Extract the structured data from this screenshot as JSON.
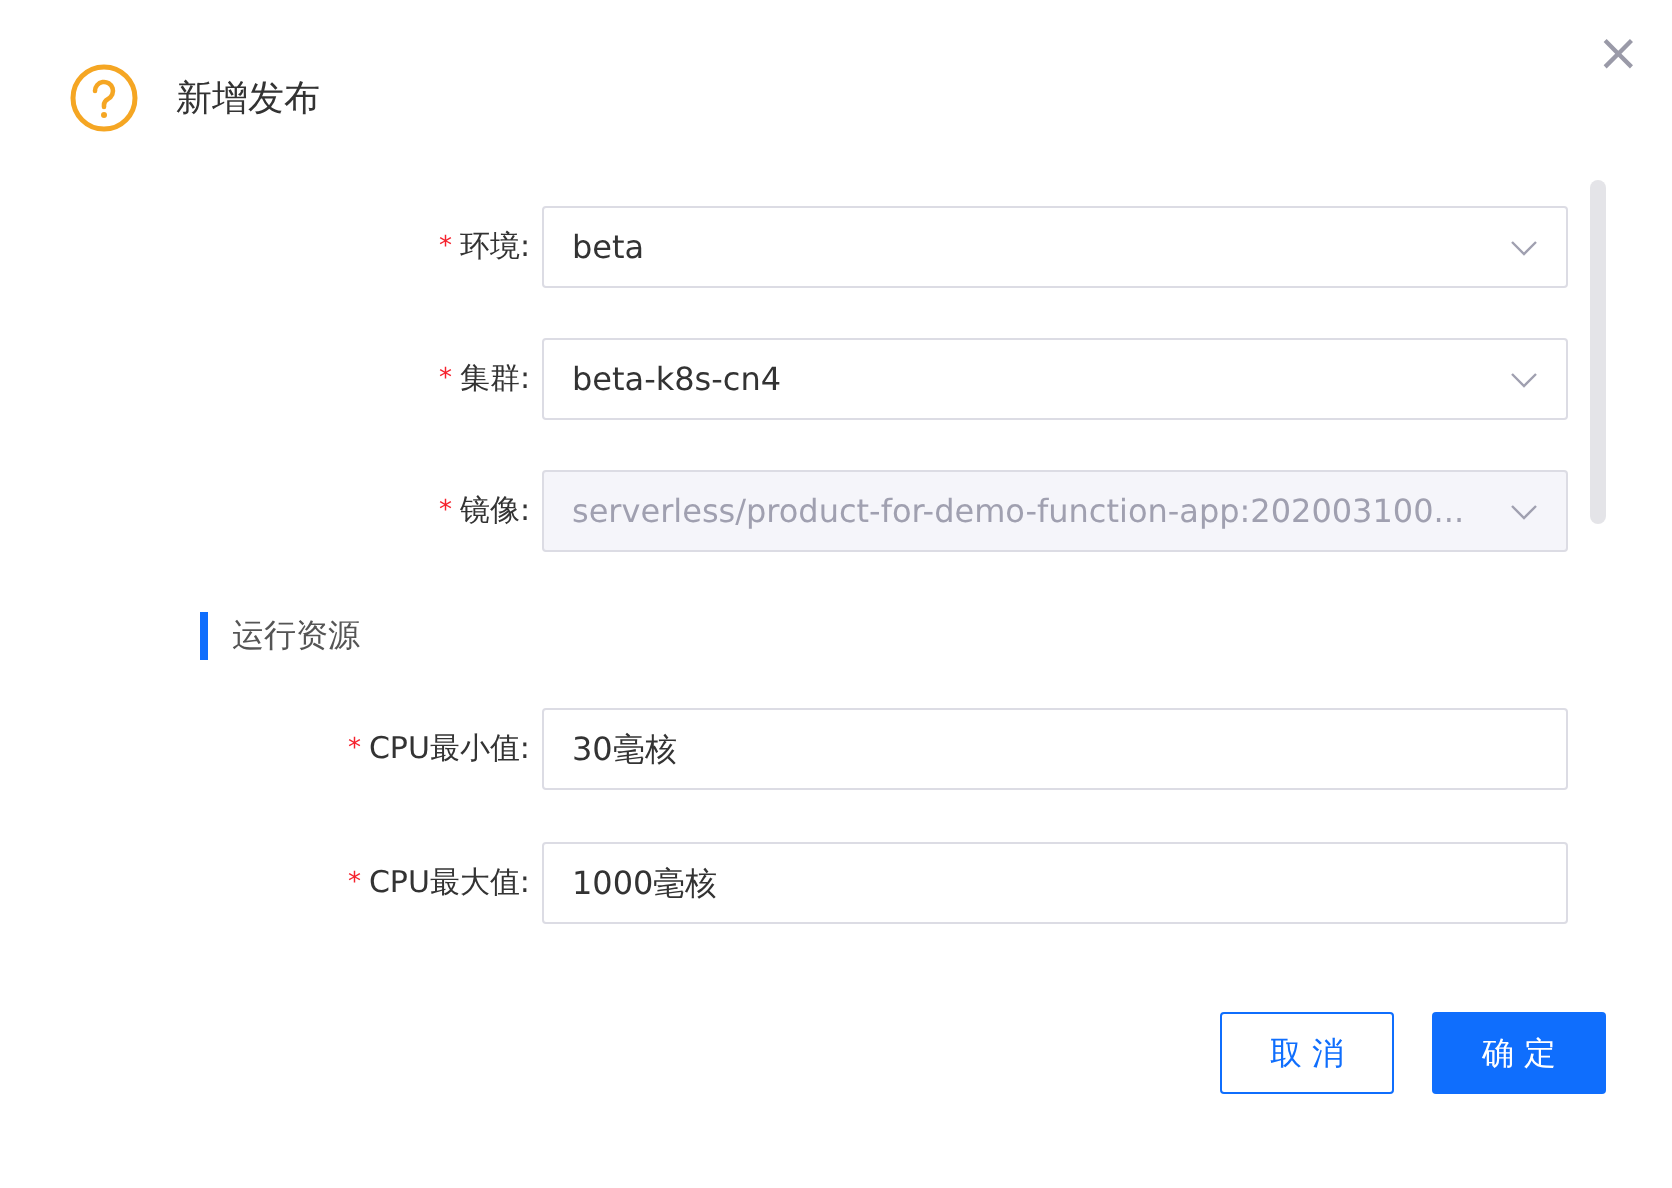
{
  "dialog": {
    "title": "新增发布",
    "close": "×"
  },
  "fields": [
    {
      "kind": "select",
      "mark": "*",
      "label": "环境:",
      "value": "beta",
      "disabled": false
    },
    {
      "kind": "select",
      "mark": "*",
      "label": "集群:",
      "value": "beta-k8s-cn4",
      "disabled": false
    },
    {
      "kind": "select",
      "mark": "*",
      "label": "镜像:",
      "value": "serverless/product-for-demo-function-app:202003100...",
      "disabled": true
    }
  ],
  "section": {
    "title": "运行资源"
  },
  "resource_fields": [
    {
      "kind": "input",
      "mark": "*",
      "label": "CPU最小值:",
      "value": "30毫核",
      "disabled": false
    },
    {
      "kind": "input",
      "mark": "*",
      "label": "CPU最大值:",
      "value": "1000毫核",
      "disabled": false
    }
  ],
  "buttons": [
    {
      "label": "取 消",
      "kind": "secondary"
    },
    {
      "label": "确 定",
      "kind": "primary"
    }
  ]
}
